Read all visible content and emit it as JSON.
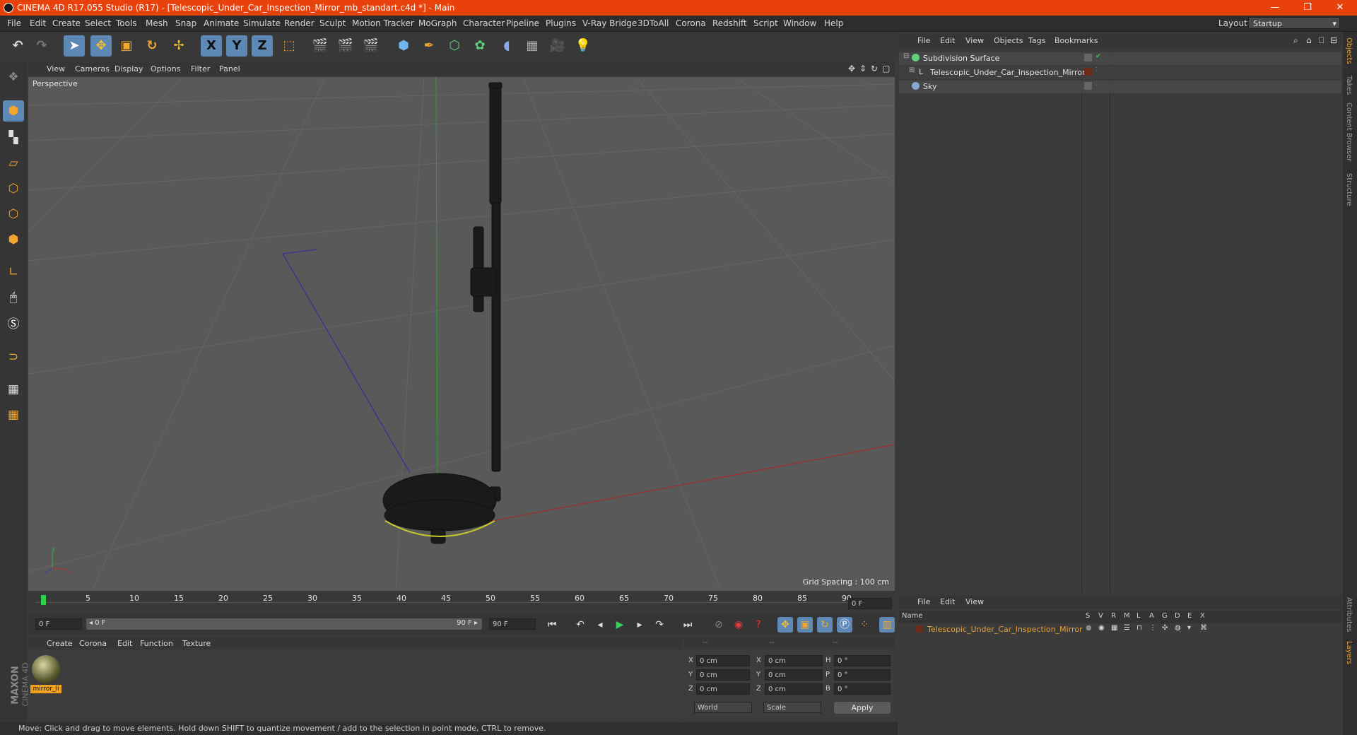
{
  "window": {
    "title": "CINEMA 4D R17.055 Studio (R17) - [Telescopic_Under_Car_Inspection_Mirror_mb_standart.c4d *] - Main",
    "minimize": "—",
    "maximize": "❐",
    "close": "✕"
  },
  "menubar": {
    "items": [
      "File",
      "Edit",
      "Create",
      "Select",
      "Tools",
      "Mesh",
      "Snap",
      "Animate",
      "Simulate",
      "Render",
      "Sculpt",
      "Motion Tracker",
      "MoGraph",
      "Character",
      "Pipeline",
      "Plugins",
      "V-Ray Bridge",
      "3DToAll",
      "Corona",
      "Redshift",
      "Script",
      "Window",
      "Help"
    ],
    "layout_label": "Layout:",
    "layout_value": "Startup"
  },
  "toolbar_icons": {
    "undo": "undo-icon",
    "redo": "redo-icon",
    "select": "select-arrow-icon",
    "move": "move-icon",
    "scale": "scale-icon",
    "rotate": "rotate-icon",
    "transform": "transform-icon",
    "x": "X",
    "y": "Y",
    "z": "Z"
  },
  "viewport": {
    "menu": [
      "View",
      "Cameras",
      "Display",
      "Options",
      "Filter",
      "Panel"
    ],
    "label": "Perspective",
    "grid_spacing": "Grid Spacing : 100 cm"
  },
  "timeline": {
    "ticks": [
      "0",
      "5",
      "10",
      "15",
      "20",
      "25",
      "30",
      "35",
      "40",
      "45",
      "50",
      "55",
      "60",
      "65",
      "70",
      "75",
      "80",
      "85",
      "90"
    ],
    "current_frame": "0 F",
    "start_field": "0 F",
    "range_start": "◂ 0 F",
    "range_end": "90 F ▸",
    "end_field": "90 F"
  },
  "material_panel": {
    "menu": [
      "Create",
      "Corona",
      "Edit",
      "Function",
      "Texture"
    ],
    "material_name": "mirror_li"
  },
  "coord_panel": {
    "headers": [
      "--",
      "--",
      "--"
    ],
    "rows": [
      {
        "a": "X",
        "av": "0 cm",
        "b": "X",
        "bv": "0 cm",
        "c": "H",
        "cv": "0 °"
      },
      {
        "a": "Y",
        "av": "0 cm",
        "b": "Y",
        "bv": "0 cm",
        "c": "P",
        "cv": "0 °"
      },
      {
        "a": "Z",
        "av": "0 cm",
        "b": "Z",
        "bv": "0 cm",
        "c": "B",
        "cv": "0 °"
      }
    ],
    "world": "World",
    "scale": "Scale",
    "apply": "Apply"
  },
  "status": "Move: Click and drag to move elements. Hold down SHIFT to quantize movement / add to the selection in point mode, CTRL to remove.",
  "object_manager": {
    "menu": [
      "File",
      "Edit",
      "View",
      "Objects",
      "Tags",
      "Bookmarks"
    ],
    "objects": [
      {
        "name": "Subdivision Surface"
      },
      {
        "name": "Telescopic_Under_Car_Inspection_Mirror"
      },
      {
        "name": "Sky"
      }
    ]
  },
  "layer_manager": {
    "menu": [
      "File",
      "Edit",
      "View"
    ],
    "header_name": "Name",
    "columns": [
      "S",
      "V",
      "R",
      "M",
      "L",
      "A",
      "G",
      "D",
      "E",
      "X"
    ],
    "layer_name": "Telescopic_Under_Car_Inspection_Mirror"
  },
  "side_tabs": [
    "Objects",
    "Takes",
    "Content Browser",
    "Structure"
  ],
  "side_tabs_bottom": [
    "Attributes",
    "Layers"
  ],
  "logo": {
    "brand": "MAXON",
    "product": "CINEMA 4D"
  },
  "colors": {
    "accent": "#e8410c",
    "selected_blue": "#5e88b5",
    "layer_orange": "#e8a13a"
  }
}
